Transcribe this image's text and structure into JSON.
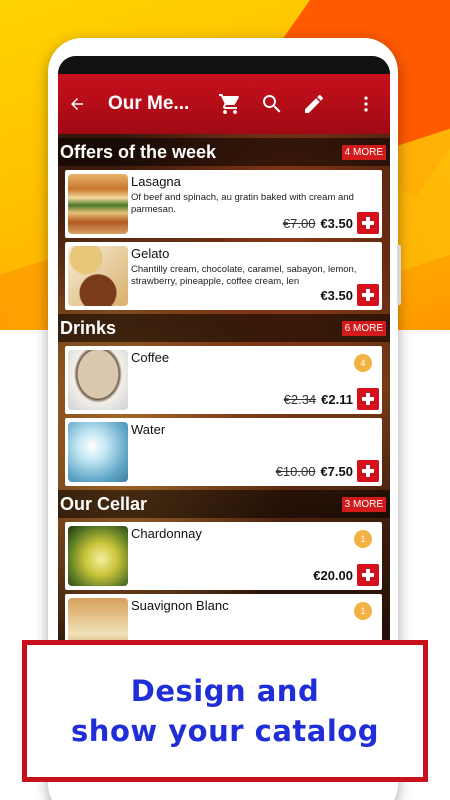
{
  "toolbar": {
    "title": "Our Me...",
    "icons": [
      "back-arrow-icon",
      "cart-icon",
      "search-icon",
      "edit-pencil-icon",
      "more-vert-icon"
    ]
  },
  "sections": [
    {
      "title": "Offers of the week",
      "more": "4 MORE",
      "items": [
        {
          "name": "Lasagna",
          "description": "Of beef and spinach, au gratin baked with cream and parmesan.",
          "old_price": "€7.00",
          "price": "€3.50"
        },
        {
          "name": "Gelato",
          "description": "Chantilly cream, chocolate, caramel, sabayon, lemon, strawberry, pineapple, coffee cream, len",
          "price": "€3.50"
        }
      ]
    },
    {
      "title": "Drinks",
      "more": "6 MORE",
      "items": [
        {
          "name": "Coffee",
          "old_price": "€2.34",
          "price": "€2.11",
          "qty": "4"
        },
        {
          "name": "Water",
          "old_price": "€10.00",
          "price": "€7.50"
        }
      ]
    },
    {
      "title": "Our Cellar",
      "more": "3 MORE",
      "items": [
        {
          "name": "Chardonnay",
          "price": "€20.00",
          "qty": "1"
        },
        {
          "name": "Suavignon Blanc",
          "qty": "1"
        }
      ]
    }
  ],
  "promo": {
    "line1": "Design and",
    "line2": "show your catalog"
  },
  "colors": {
    "toolbar": "#c8101c",
    "add_button": "#d3101c",
    "promo_text": "#1f2ed6",
    "promo_border": "#c8101c",
    "qty_badge": "#f3b143"
  }
}
